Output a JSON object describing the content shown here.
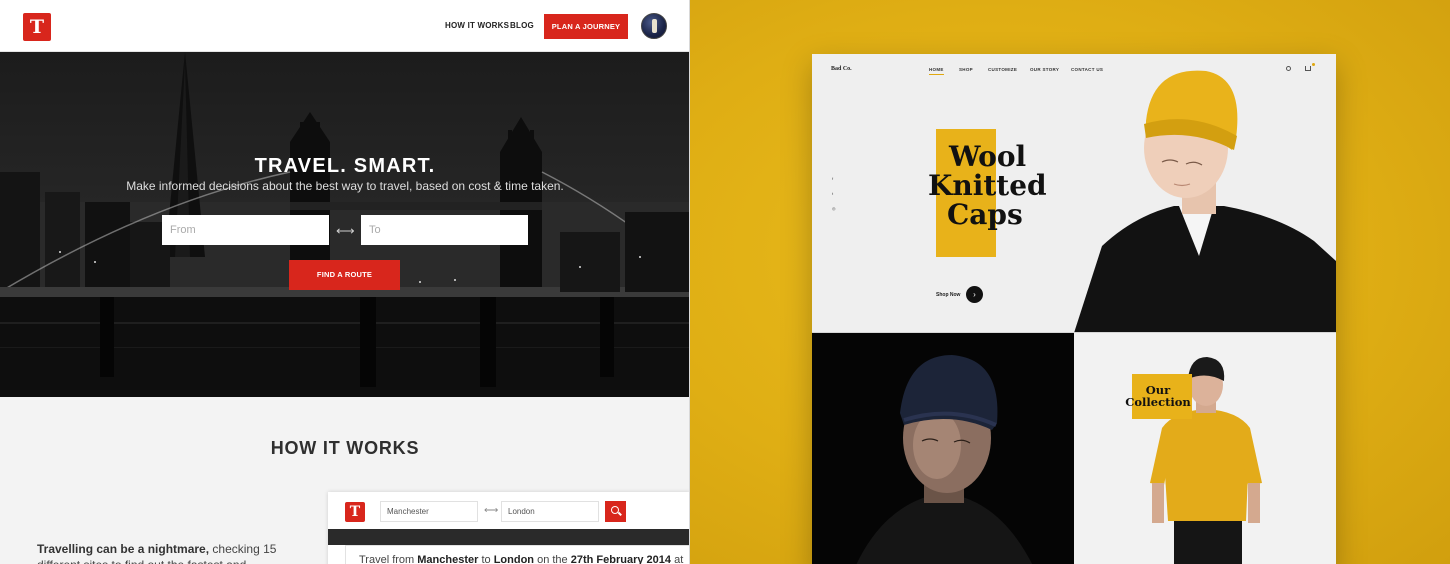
{
  "travel": {
    "logo_glyph": "T",
    "nav": {
      "how_it_works": "HOW IT WORKS",
      "blog": "BLOG",
      "cta": "PLAN A JOURNEY"
    },
    "hero": {
      "title": "TRAVEL. SMART.",
      "subtitle": "Make informed decisions about the best way to travel, based on cost & time taken.",
      "from_placeholder": "From",
      "to_placeholder": "To",
      "swap_glyph": "⟷",
      "button": "FIND A ROUTE"
    },
    "how_it_works": {
      "title": "HOW IT WORKS",
      "text_bold": "Travelling can be a nightmare,",
      "text_rest": " checking 15 different sites to find out the fastest and"
    },
    "mockup": {
      "from_value": "Manchester",
      "to_value": "London",
      "result_prefix": "Travel from ",
      "result_from": "Manchester",
      "result_mid": " to ",
      "result_to": "London",
      "result_mid2": " on the ",
      "result_date": "27th February 2014",
      "result_suffix": " at"
    },
    "colors": {
      "accent": "#d8261c"
    }
  },
  "wool": {
    "brand": "Bad Co.",
    "nav": [
      "HOME",
      "SHOP",
      "CUSTOMIZE",
      "OUR STORY",
      "CONTACT US"
    ],
    "headline": [
      "Wool",
      "Knitted",
      "Caps"
    ],
    "shop_now": "Shop Now",
    "arrow_glyph": "›",
    "social": [
      "f",
      "t",
      "◎"
    ],
    "collection_title": [
      "Our",
      "Collection"
    ],
    "colors": {
      "accent": "#e8b21a",
      "background": "#e1b116"
    }
  }
}
